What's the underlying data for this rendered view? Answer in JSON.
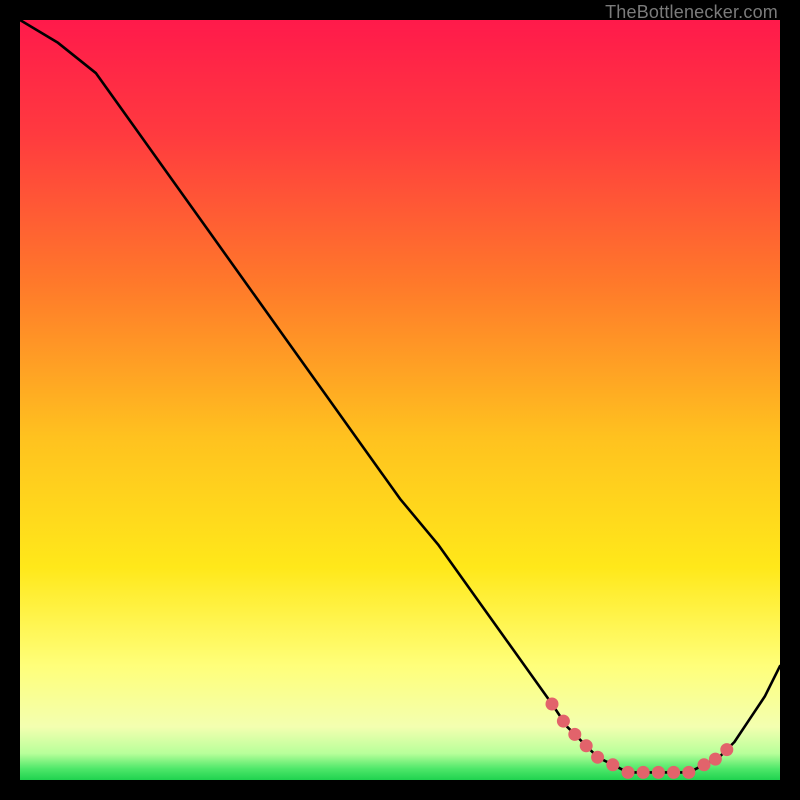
{
  "watermark": "TheBottlenecker.com",
  "colors": {
    "red": "#ff1a4b",
    "orange": "#ff8a1f",
    "yellow": "#ffe51a",
    "paleyellow": "#ffff8a",
    "green": "#1fe24f",
    "curve": "#000000",
    "marker": "#e2636b",
    "bg": "#000000"
  },
  "chart_data": {
    "type": "line",
    "title": "",
    "xlabel": "",
    "ylabel": "",
    "xlim": [
      0,
      100
    ],
    "ylim": [
      0,
      100
    ],
    "x": [
      0,
      5,
      10,
      15,
      20,
      25,
      30,
      35,
      40,
      45,
      50,
      55,
      60,
      65,
      70,
      72,
      74,
      76,
      78,
      80,
      82,
      84,
      86,
      88,
      90,
      92,
      94,
      96,
      98,
      100
    ],
    "values": [
      100,
      97,
      93,
      86,
      79,
      72,
      65,
      58,
      51,
      44,
      37,
      31,
      24,
      17,
      10,
      7,
      5,
      3,
      2,
      1,
      1,
      1,
      1,
      1,
      2,
      3,
      5,
      8,
      11,
      15
    ],
    "marker_points_x": [
      70,
      71.5,
      73,
      74.5,
      76,
      78,
      80,
      82,
      84,
      86,
      88,
      90,
      91.5,
      93
    ],
    "annotations": []
  }
}
